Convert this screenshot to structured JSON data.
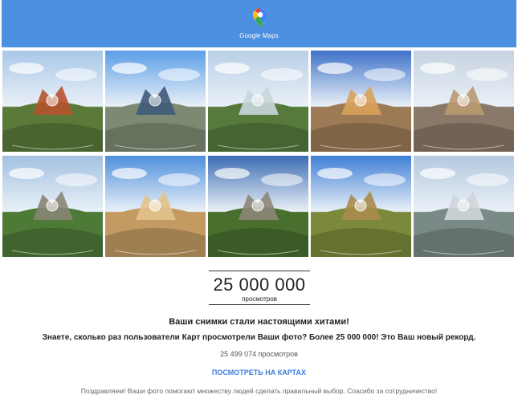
{
  "header": {
    "brand": "Google Maps",
    "logo_icon": "google-maps-pin-icon",
    "background": "#4a8fe0"
  },
  "photos": [
    {
      "subject": "waterfall-cliff",
      "sky": "#a9c7e8",
      "ground": "#5b7a3a",
      "accent": "#b5522c"
    },
    {
      "subject": "city-tower",
      "sky": "#5b9ee6",
      "ground": "#7d8a73",
      "accent": "#3f5a7a"
    },
    {
      "subject": "river-canyon",
      "sky": "#b9cfe6",
      "ground": "#557a3c",
      "accent": "#c9d6dc"
    },
    {
      "subject": "cathedral-city",
      "sky": "#3f72c9",
      "ground": "#9c7a55",
      "accent": "#d8a25a"
    },
    {
      "subject": "cathedral-square",
      "sky": "#c6d3e0",
      "ground": "#8a7868",
      "accent": "#b99a70"
    },
    {
      "subject": "mountain-ruins",
      "sky": "#a2c1e0",
      "ground": "#4e7a37",
      "accent": "#8a8574"
    },
    {
      "subject": "desert-ruins",
      "sky": "#4f8fdc",
      "ground": "#c29a62",
      "accent": "#e2c28c"
    },
    {
      "subject": "rock-pillars",
      "sky": "#3c6cb3",
      "ground": "#496f2f",
      "accent": "#8d8675"
    },
    {
      "subject": "rice-terraces",
      "sky": "#3f7fd6",
      "ground": "#7a8a3a",
      "accent": "#a88b4c"
    },
    {
      "subject": "modern-city",
      "sky": "#b4c9de",
      "ground": "#7a8a86",
      "accent": "#cfd6da"
    }
  ],
  "counter": {
    "value": "25 000 000",
    "unit": "просмотров"
  },
  "headline": "Ваши снимки стали настоящими хитами!",
  "subline": "Знаете, сколько раз пользователи Карт просмотрели Ваши фото? Более 25 000 000! Это Ваш новый рекорд.",
  "views_text": "25 499 074 просмотров",
  "link_text": "ПОСМОТРЕТЬ НА КАРТАХ",
  "footer_text": "Поздравляем! Ваши фото помогают множеству людей сделать правильный выбор. Спасибо за сотрудничество!"
}
